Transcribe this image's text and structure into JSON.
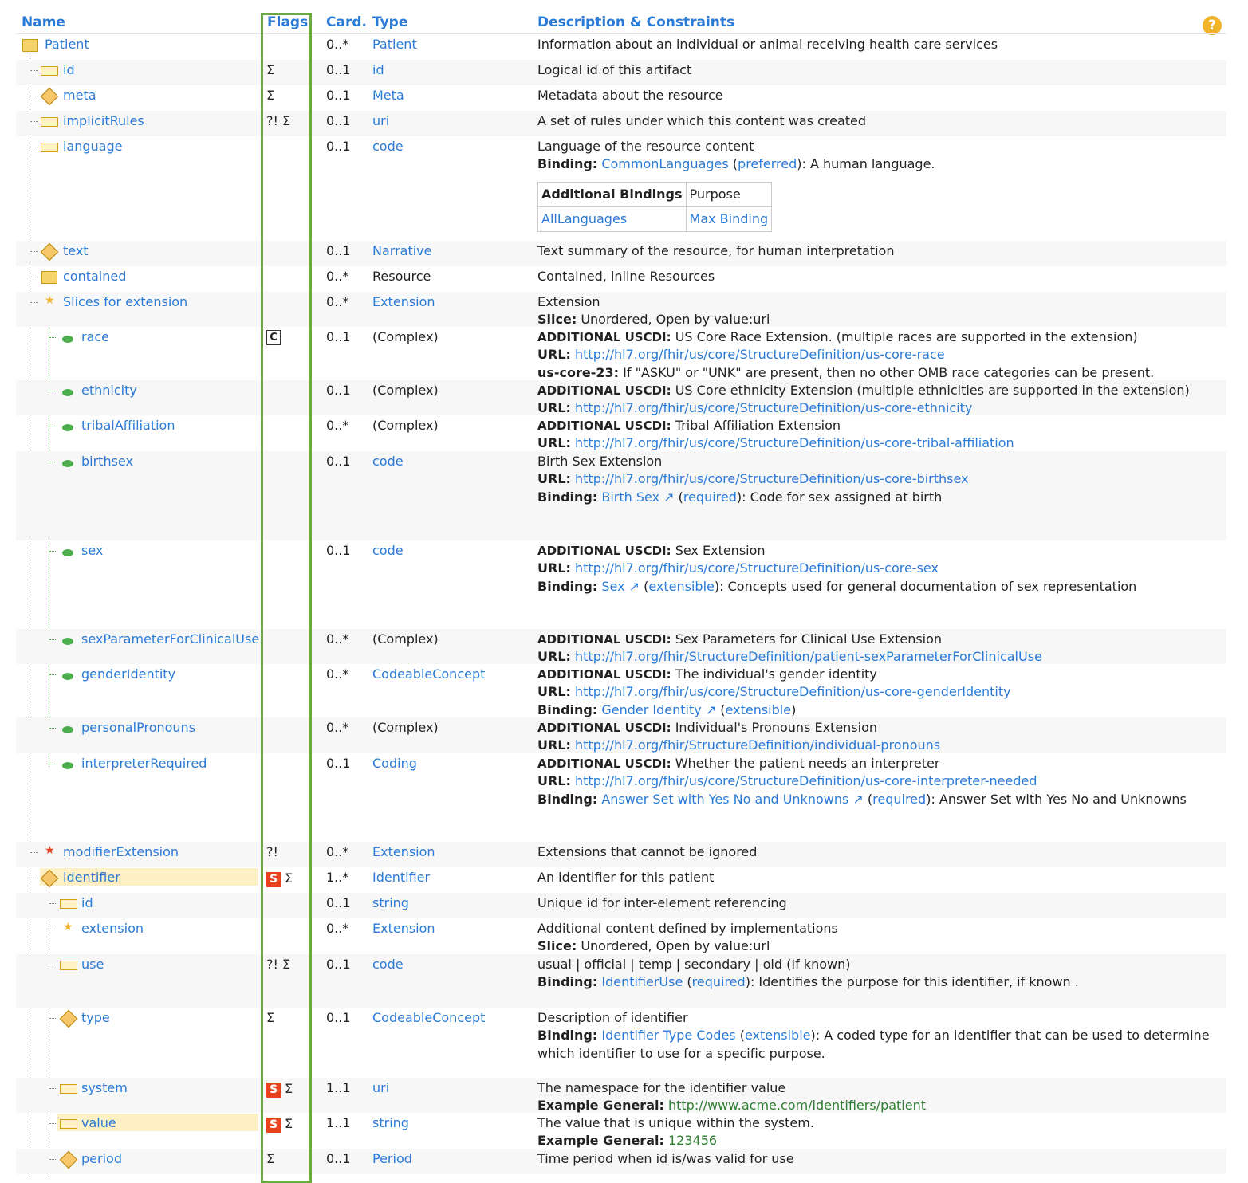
{
  "header": {
    "name": "Name",
    "flags": "Flags",
    "card": "Card.",
    "type": "Type",
    "desc": "Description & Constraints",
    "help": "?"
  },
  "rows": {
    "patient": {
      "name": "Patient",
      "card": "0..*",
      "type": "Patient",
      "d1": "Information about an individual or animal receiving health care services"
    },
    "id": {
      "name": "id",
      "flags": "Σ",
      "card": "0..1",
      "type": "id",
      "d1": "Logical id of this artifact"
    },
    "meta": {
      "name": "meta",
      "flags": "Σ",
      "card": "0..1",
      "type": "Meta",
      "d1": "Metadata about the resource"
    },
    "implicitRules": {
      "name": "implicitRules",
      "flags": "?! Σ",
      "card": "0..1",
      "type": "uri",
      "d1": "A set of rules under which this content was created"
    },
    "language": {
      "name": "language",
      "card": "0..1",
      "type": "code",
      "d1": "Language of the resource content",
      "binding_label": "Binding:",
      "binding_link": "CommonLanguages",
      "binding_strength": "preferred",
      "binding_rest": ": A human language.",
      "addb": {
        "h1": "Additional Bindings",
        "h2": "Purpose",
        "v1": "AllLanguages",
        "v2": "Max Binding"
      }
    },
    "text": {
      "name": "text",
      "card": "0..1",
      "type": "Narrative",
      "d1": "Text summary of the resource, for human interpretation"
    },
    "contained": {
      "name": "contained",
      "card": "0..*",
      "type": "Resource",
      "d1": "Contained, inline Resources"
    },
    "slices": {
      "name": "Slices for extension",
      "card": "0..*",
      "type": "Extension",
      "d1": "Extension",
      "slice_label": "Slice:",
      "slice_rest": " Unordered, Open by value:url"
    },
    "race": {
      "name": "race",
      "flags": "C",
      "card": "0..1",
      "type": "(Complex)",
      "d1b": "ADDITIONAL USCDI:",
      "d1": " US Core Race Extension. (multiple races are supported in the extension)",
      "url_label": "URL:",
      "url": "http://hl7.org/fhir/us/core/StructureDefinition/us-core-race",
      "inv_label": "us-core-23:",
      "inv": " If \"ASKU\" or \"UNK\" are present, then no other OMB race categories can be present."
    },
    "ethnicity": {
      "name": "ethnicity",
      "card": "0..1",
      "type": "(Complex)",
      "d1b": "ADDITIONAL USCDI:",
      "d1": " US Core ethnicity Extension (multiple ethnicities are supported in the extension)",
      "url_label": "URL:",
      "url": "http://hl7.org/fhir/us/core/StructureDefinition/us-core-ethnicity"
    },
    "tribal": {
      "name": "tribalAffiliation",
      "card": "0..*",
      "type": "(Complex)",
      "d1b": "ADDITIONAL USCDI:",
      "d1": " Tribal Affiliation Extension",
      "url_label": "URL:",
      "url": "http://hl7.org/fhir/us/core/StructureDefinition/us-core-tribal-affiliation"
    },
    "birthsex": {
      "name": "birthsex",
      "card": "0..1",
      "type": "code",
      "d1": "Birth Sex Extension",
      "url_label": "URL:",
      "url": "http://hl7.org/fhir/us/core/StructureDefinition/us-core-birthsex",
      "binding_label": "Binding:",
      "binding_link": "Birth Sex",
      "binding_strength": "required",
      "binding_rest": ": Code for sex assigned at birth"
    },
    "sex": {
      "name": "sex",
      "card": "0..1",
      "type": "code",
      "d1b": "ADDITIONAL USCDI:",
      "d1": " Sex Extension",
      "url_label": "URL:",
      "url": "http://hl7.org/fhir/us/core/StructureDefinition/us-core-sex",
      "binding_label": "Binding:",
      "binding_link": "Sex",
      "binding_strength": "extensible",
      "binding_rest": ": Concepts used for general documentation of sex representation"
    },
    "sexparam": {
      "name": "sexParameterForClinicalUse",
      "card": "0..*",
      "type": "(Complex)",
      "d1b": "ADDITIONAL USCDI:",
      "d1": " Sex Parameters for Clinical Use Extension",
      "url_label": "URL:",
      "url": "http://hl7.org/fhir/StructureDefinition/patient-sexParameterForClinicalUse"
    },
    "gender": {
      "name": "genderIdentity",
      "card": "0..*",
      "type": "CodeableConcept",
      "d1b": "ADDITIONAL USCDI:",
      "d1": " The individual's gender identity",
      "url_label": "URL:",
      "url": "http://hl7.org/fhir/us/core/StructureDefinition/us-core-genderIdentity",
      "binding_label": "Binding:",
      "binding_link": "Gender Identity",
      "binding_strength": "extensible",
      "binding_rest": ""
    },
    "pronouns": {
      "name": "personalPronouns",
      "card": "0..*",
      "type": "(Complex)",
      "d1b": "ADDITIONAL USCDI:",
      "d1": " Individual's Pronouns Extension",
      "url_label": "URL:",
      "url": "http://hl7.org/fhir/StructureDefinition/individual-pronouns"
    },
    "interpreter": {
      "name": "interpreterRequired",
      "card": "0..1",
      "type": "Coding",
      "d1b": "ADDITIONAL USCDI:",
      "d1": " Whether the patient needs an interpreter",
      "url_label": "URL:",
      "url": "http://hl7.org/fhir/us/core/StructureDefinition/us-core-interpreter-needed",
      "binding_label": "Binding:",
      "binding_link": "Answer Set with Yes No and Unknowns",
      "binding_strength": "required",
      "binding_rest": ": Answer Set with Yes No and Unknowns"
    },
    "modext": {
      "name": "modifierExtension",
      "flags": "?!",
      "card": "0..*",
      "type": "Extension",
      "d1": "Extensions that cannot be ignored"
    },
    "identifier": {
      "name": "identifier",
      "flag_s": "S",
      "flags": "Σ",
      "card": "1..*",
      "type": "Identifier",
      "d1": "An identifier for this patient"
    },
    "i_id": {
      "name": "id",
      "card": "0..1",
      "type": "string",
      "d1": "Unique id for inter-element referencing"
    },
    "i_ext": {
      "name": "extension",
      "card": "0..*",
      "type": "Extension",
      "d1": "Additional content defined by implementations",
      "slice_label": "Slice:",
      "slice_rest": " Unordered, Open by value:url"
    },
    "i_use": {
      "name": "use",
      "flags": "?! Σ",
      "card": "0..1",
      "type": "code",
      "d1": "usual | official | temp | secondary | old (If known)",
      "binding_label": "Binding:",
      "binding_link": "IdentifierUse",
      "binding_strength": "required",
      "binding_rest": ": Identifies the purpose for this identifier, if known ."
    },
    "i_type": {
      "name": "type",
      "flags": "Σ",
      "card": "0..1",
      "type": "CodeableConcept",
      "d1": "Description of identifier",
      "binding_label": "Binding:",
      "binding_link": "Identifier Type Codes",
      "binding_strength": "extensible",
      "binding_rest": ": A coded type for an identifier that can be used to determine",
      "d3": "which identifier to use for a specific purpose."
    },
    "i_system": {
      "name": "system",
      "flag_s": "S",
      "flags": "Σ",
      "card": "1..1",
      "type": "uri",
      "d1": "The namespace for the identifier value",
      "ex_label": "Example General:",
      "ex": "http://www.acme.com/identifiers/patient"
    },
    "i_value": {
      "name": "value",
      "flag_s": "S",
      "flags": "Σ",
      "card": "1..1",
      "type": "string",
      "d1": "The value that is unique within the system.",
      "ex_label": "Example General:",
      "ex": "123456"
    },
    "i_period": {
      "name": "period",
      "flags": "Σ",
      "card": "0..1",
      "type": "Period",
      "d1": "Time period when id is/was valid for use"
    }
  },
  "colors": {
    "link": "#2a7ad6",
    "flag_s": "#e8431f",
    "highlight": "#fdf0c4",
    "flags_box": "#6aaa42",
    "example": "#2e7d32"
  }
}
